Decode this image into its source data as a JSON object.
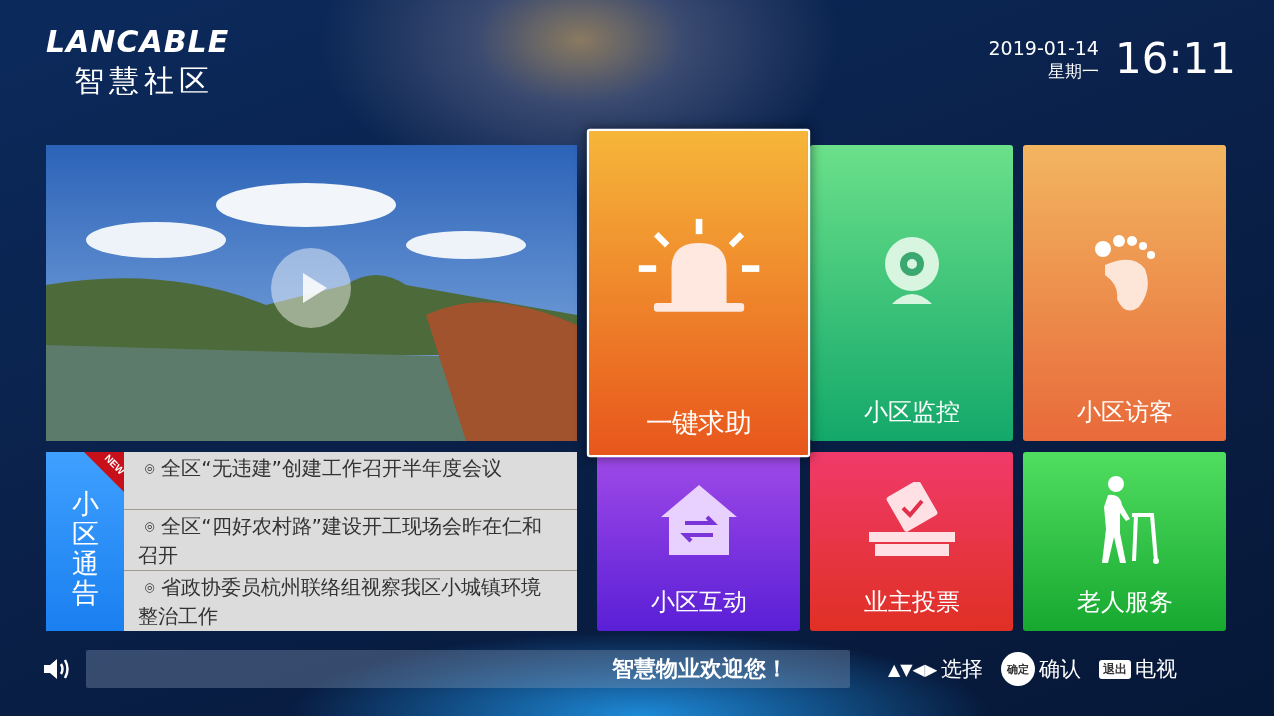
{
  "header": {
    "brand": "LANCABLE",
    "title": "智慧社区",
    "date": "2019-01-14",
    "weekday": "星期一",
    "time": "16:11"
  },
  "notices": {
    "label": "小区通告",
    "badge": "NEW",
    "items": [
      {
        "bullet": "◎",
        "text": "全区“无违建”创建工作召开半年度会议"
      },
      {
        "bullet": "◎",
        "text": "全区“四好农村路”建设开工现场会昨在仁和召开"
      },
      {
        "bullet": "◎",
        "text": "省政协委员杭州联络组视察我区小城镇环境整治工作"
      }
    ]
  },
  "tiles": [
    {
      "label": "一键求助",
      "kind": "alarm",
      "selected": true
    },
    {
      "label": "小区监控",
      "kind": "camera",
      "selected": false
    },
    {
      "label": "小区访客",
      "kind": "visitor",
      "selected": false
    },
    {
      "label": "小区互动",
      "kind": "interact",
      "selected": false
    },
    {
      "label": "业主投票",
      "kind": "vote",
      "selected": false
    },
    {
      "label": "老人服务",
      "kind": "elder",
      "selected": false
    }
  ],
  "footer": {
    "marquee": "智慧物业欢迎您！",
    "hints": [
      {
        "kind": "arrows",
        "key": "▲▼◀▶",
        "action": "选择"
      },
      {
        "kind": "round",
        "key": "确定",
        "action": "确认"
      },
      {
        "kind": "rect",
        "key": "退出",
        "action": "电视"
      }
    ]
  }
}
